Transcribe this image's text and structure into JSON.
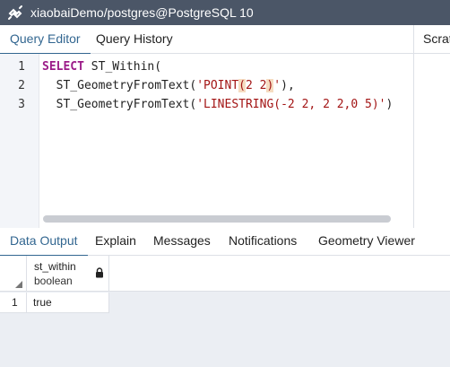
{
  "titlebar": {
    "icon": "connection-icon",
    "title": "xiaobaiDemo/postgres@PostgreSQL 10"
  },
  "top_tabs": {
    "query_editor": "Query Editor",
    "query_history": "Query History",
    "scratch": "Scratch Pad"
  },
  "editor": {
    "lines": [
      {
        "no": "1",
        "kw": "SELECT",
        "rest": " ST_Within("
      },
      {
        "no": "2",
        "pre": "  ST_GeometryFromText(",
        "str_a": "'POINT",
        "br_open": "(",
        "str_b": "2 2",
        "br_close": ")",
        "str_c": "'",
        "post": "),"
      },
      {
        "no": "3",
        "pre": "  ST_GeometryFromText(",
        "str": "'LINESTRING(-2 2, 2 2,0 5)'",
        "post": ")"
      }
    ]
  },
  "bottom_tabs": {
    "data_output": "Data Output",
    "explain": "Explain",
    "messages": "Messages",
    "notifications": "Notifications",
    "geometry_viewer": "Geometry Viewer"
  },
  "grid": {
    "column": {
      "name": "st_within",
      "type": "boolean",
      "icon": "lock-icon"
    },
    "rows": [
      {
        "num": "1",
        "value": "true"
      }
    ]
  }
}
